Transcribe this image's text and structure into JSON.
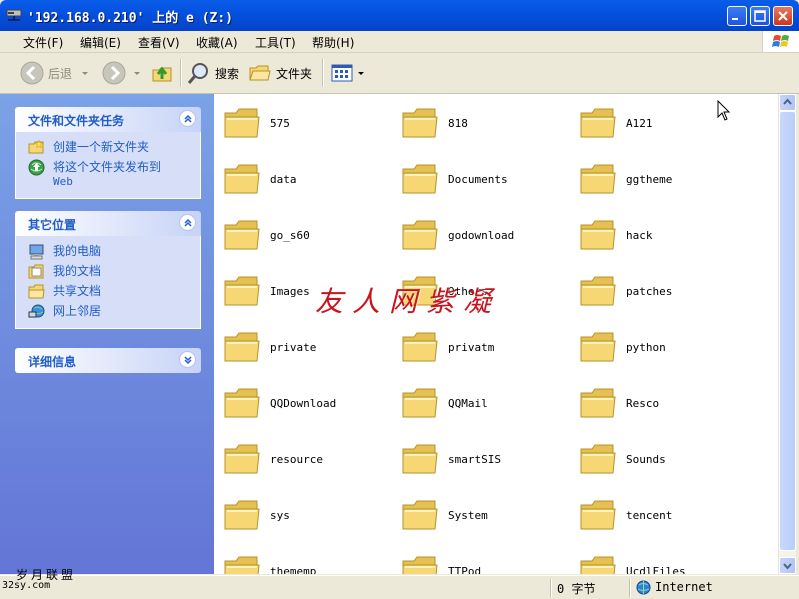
{
  "window": {
    "title": "'192.168.0.210' 上的 e (Z:)",
    "minimize_icon": "minimize-icon",
    "maximize_icon": "maximize-icon",
    "close_icon": "close-icon"
  },
  "menu": [
    "文件(F)",
    "编辑(E)",
    "查看(V)",
    "收藏(A)",
    "工具(T)",
    "帮助(H)"
  ],
  "toolbar": {
    "back": "后退",
    "search": "搜索",
    "folders": "文件夹"
  },
  "tasks": {
    "file_tasks": {
      "title": "文件和文件夹任务",
      "items": [
        {
          "label": "创建一个新文件夹",
          "icon": "new-folder-icon"
        },
        {
          "label": "将这个文件夹发布到",
          "label2": "Web",
          "icon": "publish-web-icon"
        }
      ]
    },
    "other_places": {
      "title": "其它位置",
      "items": [
        {
          "label": "我的电脑",
          "icon": "my-computer-icon"
        },
        {
          "label": "我的文档",
          "icon": "my-documents-icon"
        },
        {
          "label": "共享文档",
          "icon": "shared-documents-icon"
        },
        {
          "label": "网上邻居",
          "icon": "network-places-icon"
        }
      ]
    },
    "details": {
      "title": "详细信息"
    }
  },
  "files": [
    "575",
    "818",
    "A121",
    "data",
    "Documents",
    "ggtheme",
    "go_s60",
    "godownload",
    "hack",
    "Images",
    "Others",
    "patches",
    "private",
    "privatm",
    "python",
    "QQDownload",
    "QQMail",
    "Resco",
    "resource",
    "smartSIS",
    "Sounds",
    "sys",
    "System",
    "tencent",
    "thememp",
    "TTPod",
    "UcdlFiles"
  ],
  "status": {
    "size": "0 字节",
    "zone": "Internet"
  },
  "overlay": {
    "watermark": "友人网紫凝",
    "site_name": "岁月联盟",
    "site_url": "32sy.com"
  },
  "colors": {
    "title_blue": "#0551e0",
    "task_pane_blue": "#6375d6",
    "task_link": "#215dc6",
    "folder_yellow": "#f7d774",
    "watermark_red": "#c8141c"
  }
}
